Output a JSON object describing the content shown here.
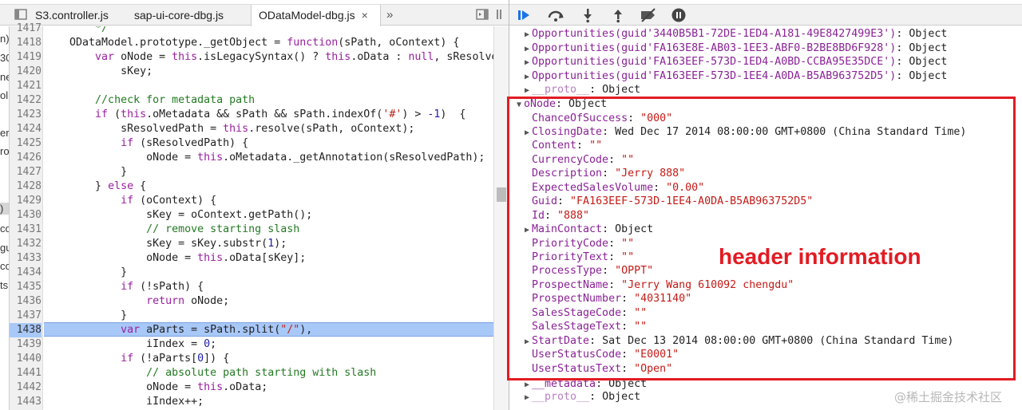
{
  "editor": {
    "tabs": [
      {
        "label": "S3.controller.js"
      },
      {
        "label": "sap-ui-core-dbg.js"
      },
      {
        "label": "ODataModel-dbg.js",
        "active": true
      }
    ],
    "close_glyph": "×",
    "more_glyph": "»",
    "nav_fragments": [
      "n)",
      "30",
      "ne",
      "ol",
      "er",
      "ro",
      ")",
      "co",
      "gu",
      "co",
      "ts"
    ],
    "line_numbers": [
      "1417",
      "1418",
      "1419",
      "1420",
      "1421",
      "1422",
      "1423",
      "1424",
      "1425",
      "1426",
      "1427",
      "1428",
      "1429",
      "1430",
      "1431",
      "1432",
      "1433",
      "1434",
      "1435",
      "1436",
      "1437",
      "1438",
      "1439",
      "1440",
      "1441",
      "1442",
      "1443"
    ],
    "highlighted_line": "1438"
  },
  "scope": {
    "top_rows": [
      {
        "key": "Opportunities(guid'3440B5B1-72DE-1ED4-A181-49E8427499E3')",
        "value": ": Object"
      },
      {
        "key": "Opportunities(guid'FA163E8E-AB03-1EE3-ABF0-B2BE8BD6F928')",
        "value": ": Object"
      },
      {
        "key": "Opportunities(guid'FA163EEF-573D-1ED4-A0BD-CCBA95E35DCE')",
        "value": ": Object"
      },
      {
        "key": "Opportunities(guid'FA163EEF-573D-1EE4-A0DA-B5AB963752D5')",
        "value": ": Object"
      }
    ],
    "proto_row": {
      "key": "__proto__",
      "value": ": Object"
    },
    "onode": {
      "key": "oNode",
      "value": ": Object"
    },
    "props": [
      {
        "key": "ChanceOfSuccess",
        "value": "\"000\"",
        "type": "string"
      },
      {
        "key": "ClosingDate",
        "value": "Wed Dec 17 2014 08:00:00 GMT+0800 (China Standard Time)",
        "type": "object",
        "expandable": true
      },
      {
        "key": "Content",
        "value": "\"\"",
        "type": "string"
      },
      {
        "key": "CurrencyCode",
        "value": "\"\"",
        "type": "string"
      },
      {
        "key": "Description",
        "value": "\"Jerry 888\"",
        "type": "string"
      },
      {
        "key": "ExpectedSalesVolume",
        "value": "\"0.00\"",
        "type": "string"
      },
      {
        "key": "Guid",
        "value": "\"FA163EEF-573D-1EE4-A0DA-B5AB963752D5\"",
        "type": "string"
      },
      {
        "key": "Id",
        "value": "\"888\"",
        "type": "string"
      },
      {
        "key": "MainContact",
        "value": "Object",
        "type": "object",
        "expandable": true
      },
      {
        "key": "PriorityCode",
        "value": "\"\"",
        "type": "string"
      },
      {
        "key": "PriorityText",
        "value": "\"\"",
        "type": "string"
      },
      {
        "key": "ProcessType",
        "value": "\"OPPT\"",
        "type": "string"
      },
      {
        "key": "ProspectName",
        "value": "\"Jerry Wang 610092 chengdu\"",
        "type": "string"
      },
      {
        "key": "ProspectNumber",
        "value": "\"4031140\"",
        "type": "string"
      },
      {
        "key": "SalesStageCode",
        "value": "\"\"",
        "type": "string"
      },
      {
        "key": "SalesStageText",
        "value": "\"\"",
        "type": "string"
      },
      {
        "key": "StartDate",
        "value": "Sat Dec 13 2014 08:00:00 GMT+0800 (China Standard Time)",
        "type": "object",
        "expandable": true
      },
      {
        "key": "UserStatusCode",
        "value": "\"E0001\"",
        "type": "string"
      },
      {
        "key": "UserStatusText",
        "value": "\"Open\"",
        "type": "string"
      }
    ],
    "metadata_row": {
      "key": "__metadata",
      "value": ": Object"
    },
    "proto_row2": {
      "key": "__proto__",
      "value": ": Object"
    }
  },
  "annotation": {
    "text": "header information",
    "color": "#e21b23"
  },
  "watermark": "@稀土掘金技术社区",
  "colors": {
    "accent": "#1a73e8",
    "highlight": "#a8c8f8",
    "annotation": "#e21b23"
  }
}
